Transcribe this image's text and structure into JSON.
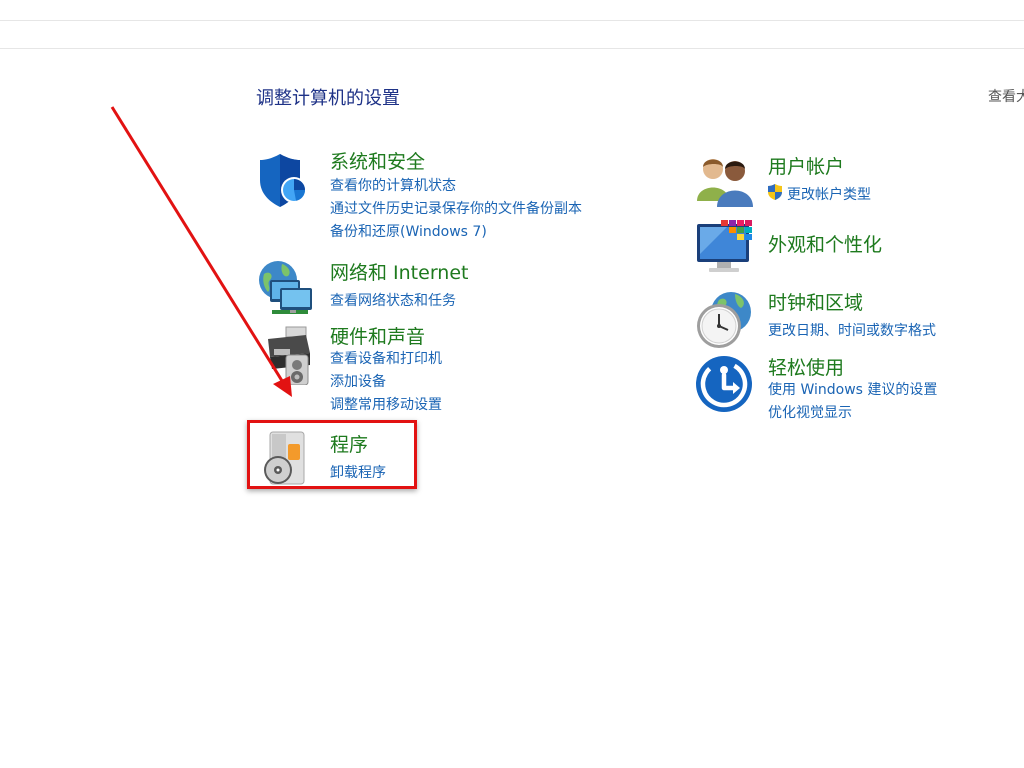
{
  "page": {
    "heading": "调整计算机的设置",
    "view_by_fragment": "查看大"
  },
  "left_categories": [
    {
      "title": "系统和安全",
      "icon": "shield-icon",
      "links": [
        "查看你的计算机状态",
        "通过文件历史记录保存你的文件备份副本",
        "备份和还原(Windows 7)"
      ]
    },
    {
      "title": "网络和 Internet",
      "icon": "network-globe-icon",
      "links": [
        "查看网络状态和任务"
      ]
    },
    {
      "title": "硬件和声音",
      "icon": "printer-speaker-icon",
      "links": [
        "查看设备和打印机",
        "添加设备",
        "调整常用移动设置"
      ]
    },
    {
      "title": "程序",
      "icon": "programs-disc-icon",
      "links": [
        "卸载程序"
      ]
    }
  ],
  "right_categories": [
    {
      "title": "用户帐户",
      "icon": "users-icon",
      "links": [
        "更改帐户类型"
      ],
      "link_icon": "uac-shield-icon"
    },
    {
      "title": "外观和个性化",
      "icon": "monitor-palette-icon",
      "links": []
    },
    {
      "title": "时钟和区域",
      "icon": "clock-globe-icon",
      "links": [
        "更改日期、时间或数字格式"
      ]
    },
    {
      "title": "轻松使用",
      "icon": "ease-of-access-icon",
      "links": [
        "使用 Windows 建议的设置",
        "优化视觉显示"
      ]
    }
  ],
  "annotation": {
    "highlight_color": "#e21212",
    "arrow_color": "#e21212"
  }
}
